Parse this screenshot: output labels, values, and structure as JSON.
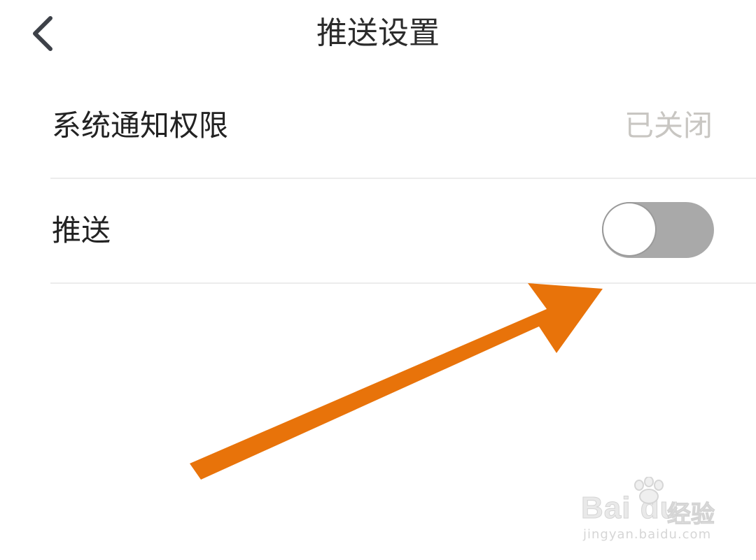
{
  "header": {
    "title": "推送设置",
    "back_icon": "chevron-left-icon"
  },
  "settings": {
    "notification_permission": {
      "label": "系统通知权限",
      "value": "已关闭"
    },
    "push": {
      "label": "推送",
      "toggle_on": false
    }
  },
  "annotation": {
    "color": "#e8730a",
    "icon": "arrow-annotation"
  },
  "watermark": {
    "brand": "Bai du",
    "product": "经验",
    "url": "jingyan.baidu.com"
  },
  "colors": {
    "title_text": "#2b2b2b",
    "value_text": "#c8c6c2",
    "toggle_off": "#a9a9a9",
    "divider": "#ececec"
  }
}
